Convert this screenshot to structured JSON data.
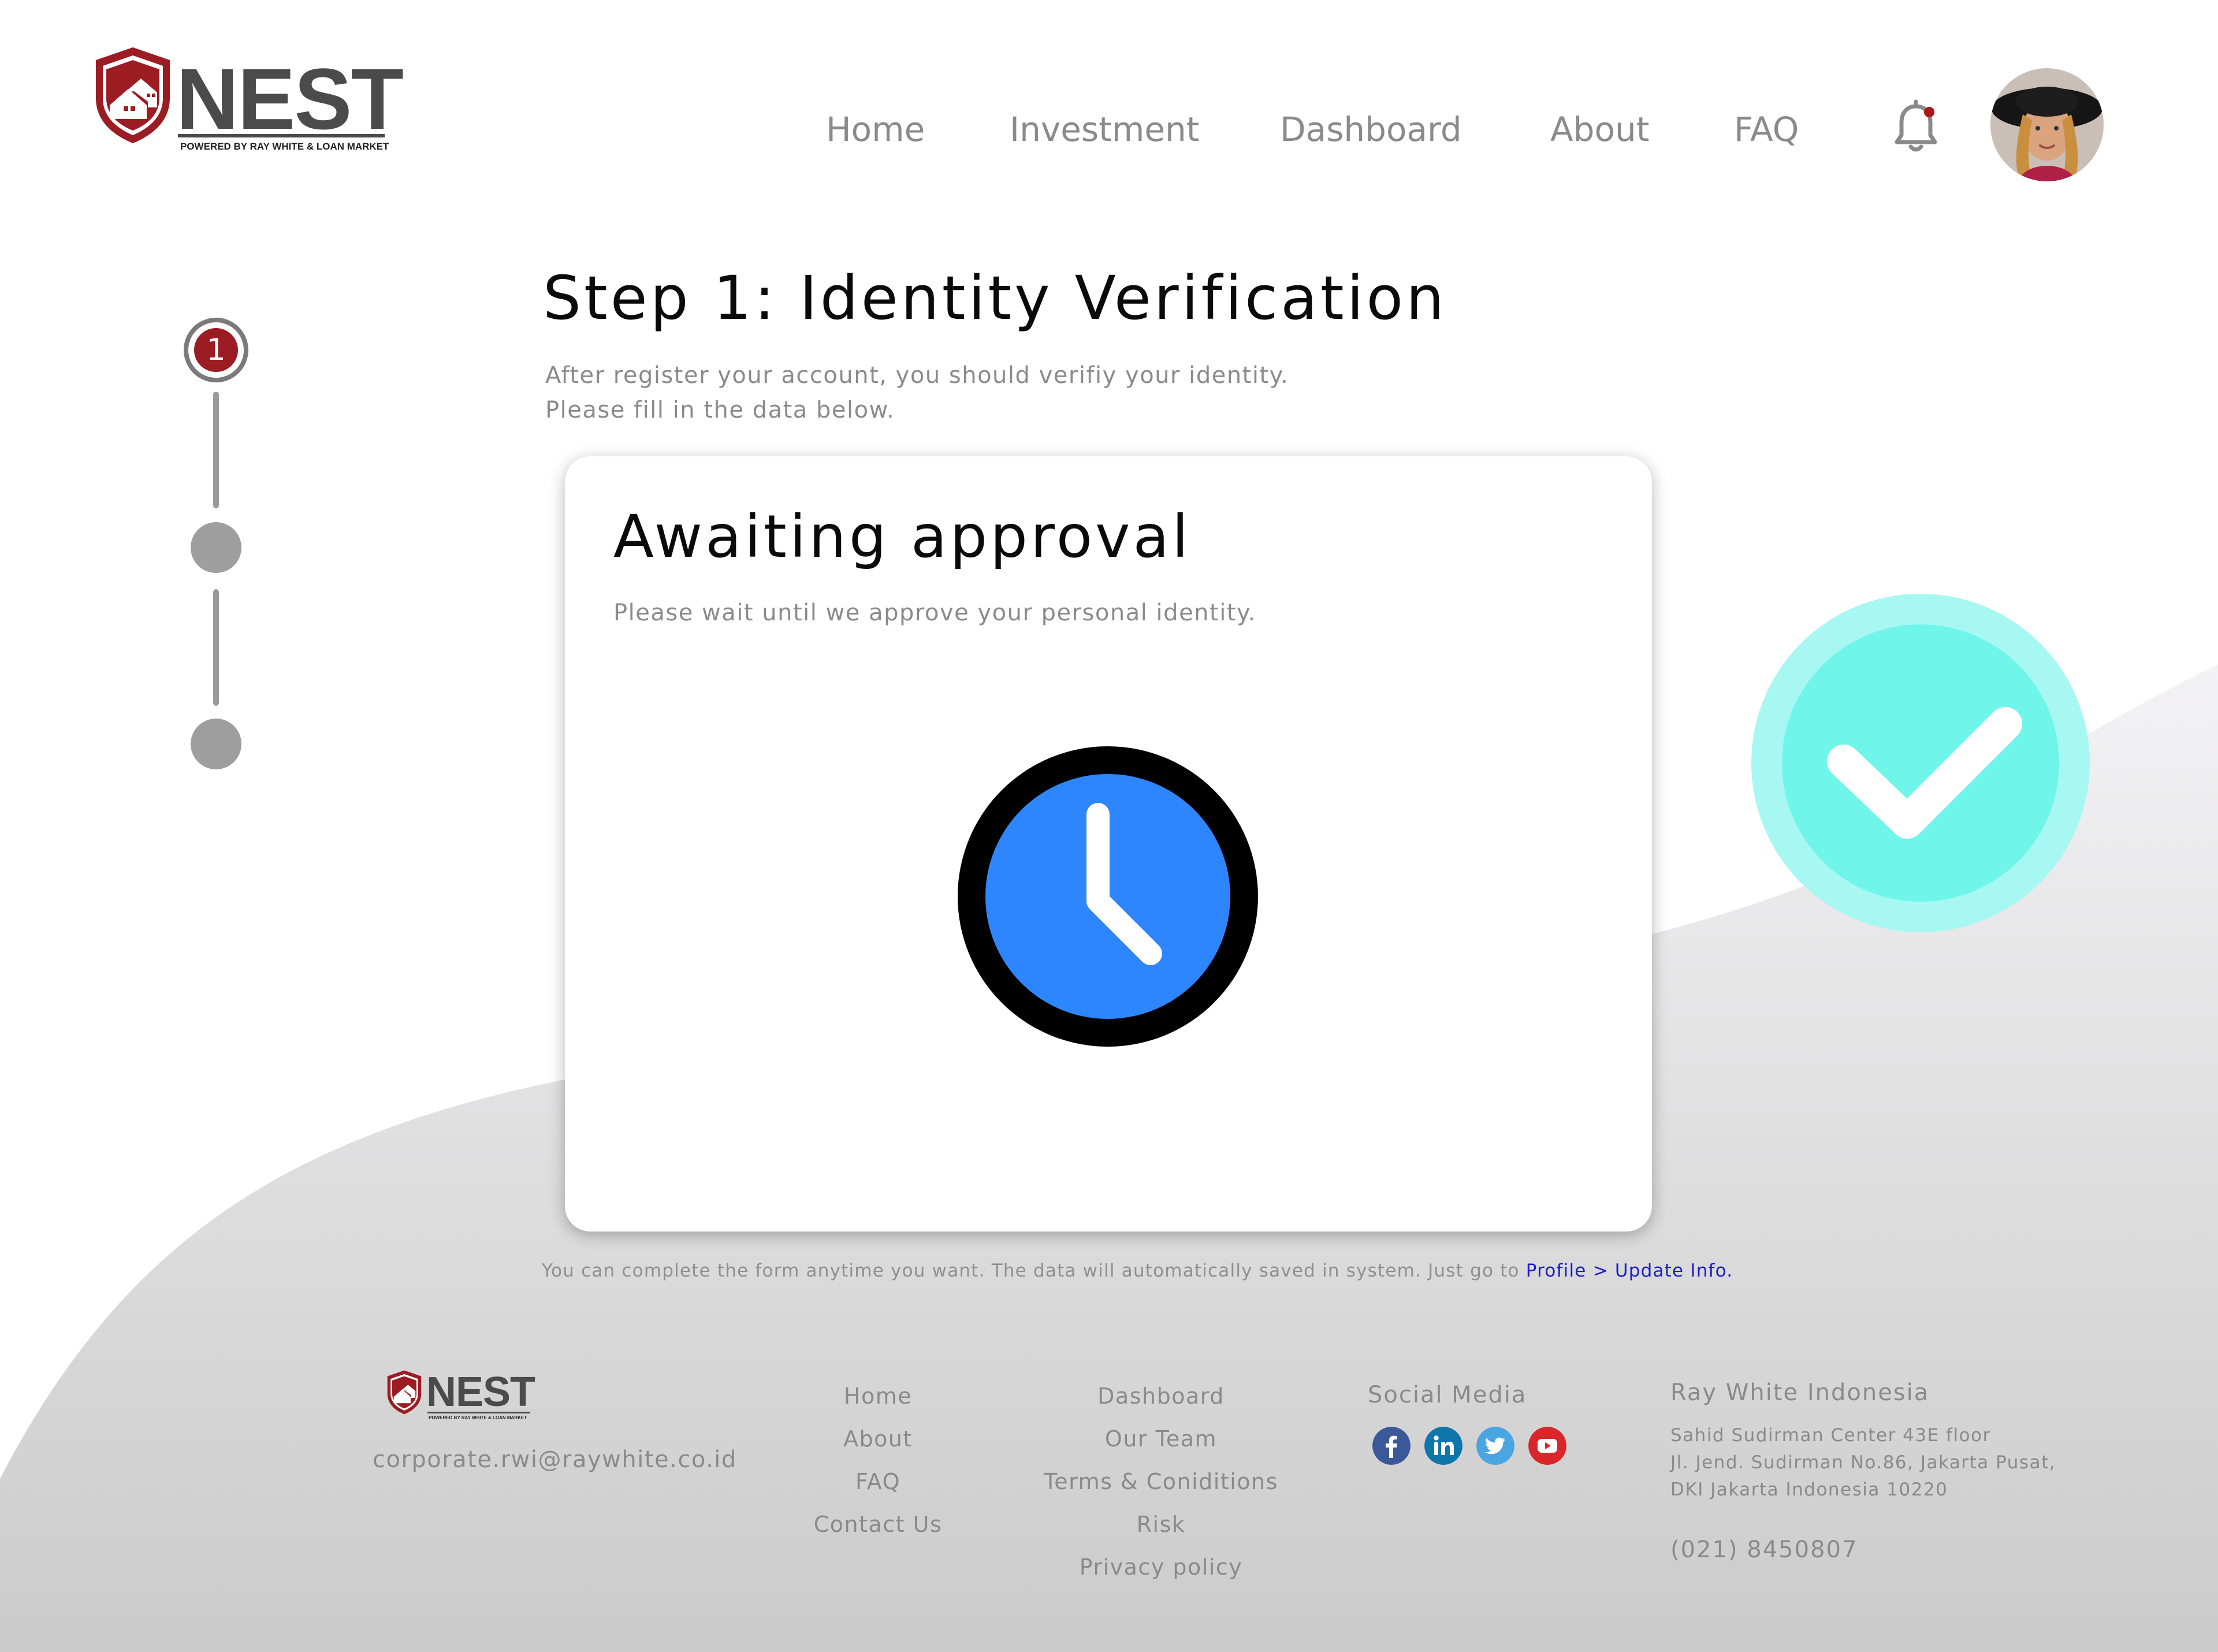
{
  "header": {
    "logo_text": "NEST",
    "logo_tagline": "POWERED BY RAY WHITE & LOAN MARKET",
    "nav": [
      "Home",
      "Investment",
      "Dashboard",
      "About",
      "FAQ"
    ],
    "has_notification": true
  },
  "stepper": {
    "active_step": "1",
    "total_steps": 3
  },
  "main": {
    "title": "Step 1: Identity Verification",
    "subtitle_line1": "After register your account, you should verifiy your identity.",
    "subtitle_line2": "Please fill in the data below."
  },
  "card": {
    "title": "Awaiting approval",
    "description": "Please wait until we approve your personal identity."
  },
  "note": {
    "text": "You can complete the form anytime you want. The data will automatically saved in system. Just go to ",
    "link": "Profile > Update Info."
  },
  "footer": {
    "logo_text": "NEST",
    "logo_tagline": "POWERED BY RAY WHITE & LOAN MARKET",
    "email": "corporate.rwi@raywhite.co.id",
    "col1": [
      "Home",
      "About",
      "FAQ",
      "Contact Us"
    ],
    "col2": [
      "Dashboard",
      "Our Team",
      "Terms & Coniditions",
      "Risk",
      "Privacy policy"
    ],
    "social_heading": "Social Media",
    "social_icons": [
      "facebook-icon",
      "linkedin-icon",
      "twitter-icon",
      "youtube-icon"
    ],
    "company": "Ray White Indonesia",
    "address_line1": "Sahid Sudirman Center 43E floor",
    "address_line2": "Jl. Jend. Sudirman No.86, Jakarta Pusat,",
    "address_line3": "DKI Jakarta Indonesia 10220",
    "phone": "(021) 8450807"
  },
  "colors": {
    "brand_red": "#9b1c22",
    "clock_blue": "#2e86ff",
    "check_teal": "#6ff5ea",
    "link_blue": "#1c1cc9",
    "text_gray": "#8a8a8a"
  }
}
